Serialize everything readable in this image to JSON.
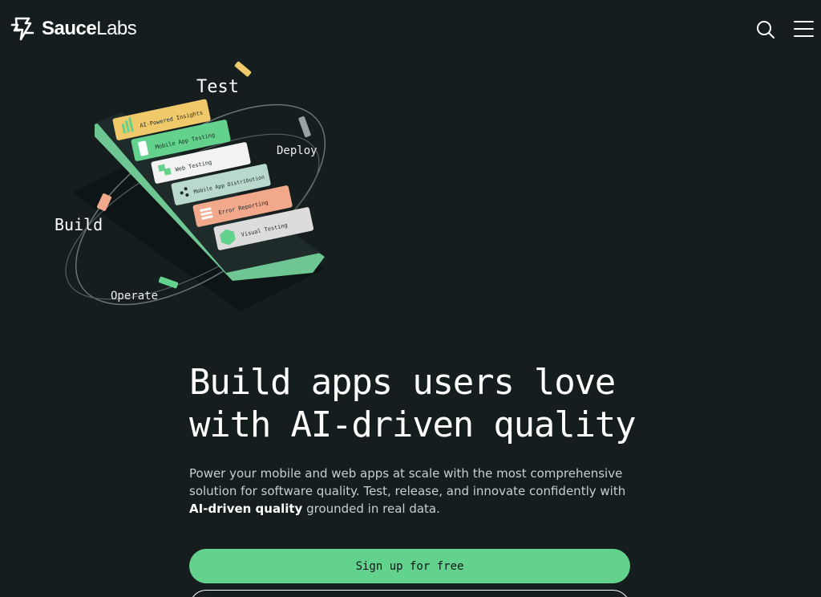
{
  "header": {
    "logo_bold": "Sauce",
    "logo_light": "Labs",
    "search_icon": "search-icon",
    "menu_icon": "hamburger-menu-icon"
  },
  "hero_art": {
    "labels": {
      "test": "Test",
      "build": "Build",
      "deploy": "Deploy",
      "operate": "Operate"
    },
    "cards": [
      {
        "label": "AI-Powered Insights",
        "color": "#f0c96a"
      },
      {
        "label": "Mobile App Testing",
        "color": "#62d28c"
      },
      {
        "label": "Web Testing",
        "color": "#f2f2f2"
      },
      {
        "label": "Mobile App Distribution",
        "color": "#b8d9cb"
      },
      {
        "label": "Error Reporting",
        "color": "#f2a88a"
      },
      {
        "label": "Visual Testing",
        "color": "#dcdcdc"
      }
    ]
  },
  "hero": {
    "headline_line1": "Build apps users love",
    "headline_line2": "with AI-driven quality",
    "sub_part1": "Power your mobile and web apps at scale with the most comprehensive solution for software quality. Test, release, and innovate confidently with ",
    "sub_bold": "AI-driven quality",
    "sub_part2": " grounded in real data.",
    "cta_primary": "Sign up for free"
  },
  "colors": {
    "background": "#151d1e",
    "accent_green": "#62d28c",
    "text_muted": "#c7cfcf"
  }
}
